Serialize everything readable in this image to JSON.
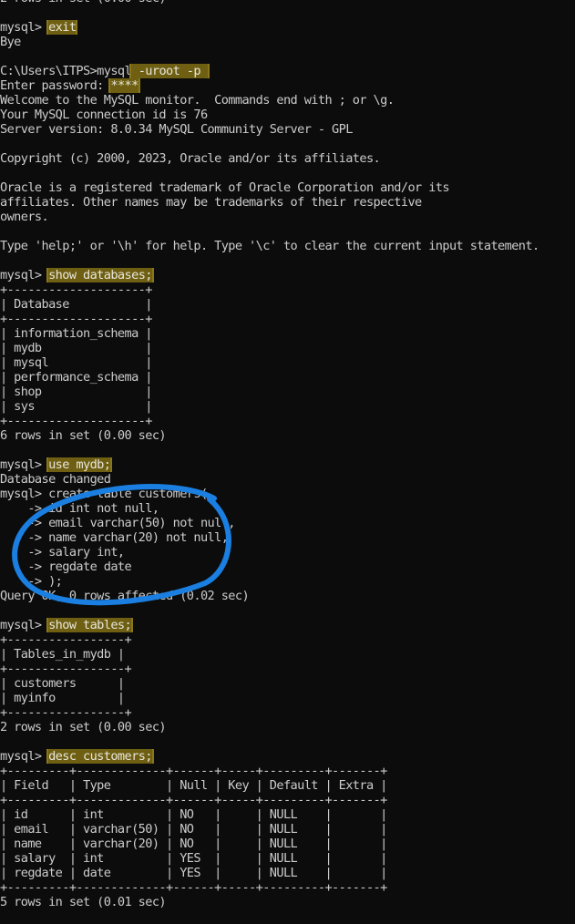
{
  "annotation_color": "#1a7fe0",
  "highlight_color": "#6e5f12",
  "terminal": {
    "lines": [
      {
        "pre": "2 rows in set (0.00 sec)"
      },
      {
        "pre": ""
      },
      {
        "pre": "mysql> ",
        "cmd": "exit",
        "post": ""
      },
      {
        "pre": "Bye"
      },
      {
        "pre": ""
      },
      {
        "pre": "C:\\Users\\ITPS>mysql",
        "cmd": " -uroot -p ",
        "post": ""
      },
      {
        "pre": "Enter password: ",
        "cmd": "****",
        "post": ""
      },
      {
        "pre": "Welcome to the MySQL monitor.  Commands end with ; or \\g."
      },
      {
        "pre": "Your MySQL connection id is 76"
      },
      {
        "pre": "Server version: 8.0.34 MySQL Community Server - GPL"
      },
      {
        "pre": ""
      },
      {
        "pre": "Copyright (c) 2000, 2023, Oracle and/or its affiliates."
      },
      {
        "pre": ""
      },
      {
        "pre": "Oracle is a registered trademark of Oracle Corporation and/or its"
      },
      {
        "pre": "affiliates. Other names may be trademarks of their respective"
      },
      {
        "pre": "owners."
      },
      {
        "pre": ""
      },
      {
        "pre": "Type 'help;' or '\\h' for help. Type '\\c' to clear the current input statement."
      },
      {
        "pre": ""
      },
      {
        "pre": "mysql> ",
        "cmd": "show databases;",
        "post": ""
      },
      {
        "pre": "+--------------------+"
      },
      {
        "pre": "| Database           |"
      },
      {
        "pre": "+--------------------+"
      },
      {
        "pre": "| information_schema |"
      },
      {
        "pre": "| mydb               |"
      },
      {
        "pre": "| mysql              |"
      },
      {
        "pre": "| performance_schema |"
      },
      {
        "pre": "| shop               |"
      },
      {
        "pre": "| sys                |"
      },
      {
        "pre": "+--------------------+"
      },
      {
        "pre": "6 rows in set (0.00 sec)"
      },
      {
        "pre": ""
      },
      {
        "pre": "mysql> ",
        "cmd": "use mydb;",
        "post": ""
      },
      {
        "pre": "Database changed"
      },
      {
        "pre": "mysql> create table customers("
      },
      {
        "pre": "    -> id int not null,"
      },
      {
        "pre": "    -> email varchar(50) not null,"
      },
      {
        "pre": "    -> name varchar(20) not null,"
      },
      {
        "pre": "    -> salary int,"
      },
      {
        "pre": "    -> regdate date"
      },
      {
        "pre": "    -> );"
      },
      {
        "pre": "Query OK, 0 rows affected (0.02 sec)"
      },
      {
        "pre": ""
      },
      {
        "pre": "mysql> ",
        "cmd": "show tables;",
        "post": ""
      },
      {
        "pre": "+-----------------+"
      },
      {
        "pre": "| Tables_in_mydb |"
      },
      {
        "pre": "+-----------------+"
      },
      {
        "pre": "| customers      |"
      },
      {
        "pre": "| myinfo         |"
      },
      {
        "pre": "+-----------------+"
      },
      {
        "pre": "2 rows in set (0.00 sec)"
      },
      {
        "pre": ""
      },
      {
        "pre": "mysql> ",
        "cmd": "desc customers;",
        "post": ""
      },
      {
        "pre": "+---------+-------------+------+-----+---------+-------+"
      },
      {
        "pre": "| Field   | Type        | Null | Key | Default | Extra |"
      },
      {
        "pre": "+---------+-------------+------+-----+---------+-------+"
      },
      {
        "pre": "| id      | int         | NO   |     | NULL    |       |"
      },
      {
        "pre": "| email   | varchar(50) | NO   |     | NULL    |       |"
      },
      {
        "pre": "| name    | varchar(20) | NO   |     | NULL    |       |"
      },
      {
        "pre": "| salary  | int         | YES  |     | NULL    |       |"
      },
      {
        "pre": "| regdate | date        | YES  |     | NULL    |       |"
      },
      {
        "pre": "+---------+-------------+------+-----+---------+-------+"
      },
      {
        "pre": "5 rows in set (0.01 sec)"
      }
    ]
  }
}
